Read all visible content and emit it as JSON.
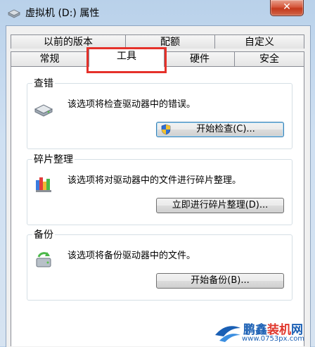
{
  "window": {
    "title": "虚拟机 (D:) 属性",
    "close_label": "✕"
  },
  "tabs": {
    "row1": [
      "以前的版本",
      "配额",
      "自定义"
    ],
    "row2": [
      "常规",
      "工具",
      "硬件",
      "安全"
    ],
    "active": "工具"
  },
  "groups": {
    "error_check": {
      "label": "查错",
      "text": "该选项将检查驱动器中的错误。",
      "button": "开始检查(C)...",
      "icon": "drive-icon"
    },
    "defrag": {
      "label": "碎片整理",
      "text": "该选项将对驱动器中的文件进行碎片整理。",
      "button": "立即进行碎片整理(D)...",
      "icon": "defrag-icon"
    },
    "backup": {
      "label": "备份",
      "text": "该选项将备份驱动器中的文件。",
      "button": "开始备份(B)...",
      "icon": "backup-icon"
    }
  },
  "watermark": {
    "brand_blue": "鹏鑫",
    "brand_red": "装机",
    "brand_blue2": "网",
    "url": "www.0753px.com"
  },
  "colors": {
    "highlight": "#e5312a",
    "close": "#c4391c",
    "watermark": "#1a5fb4"
  }
}
